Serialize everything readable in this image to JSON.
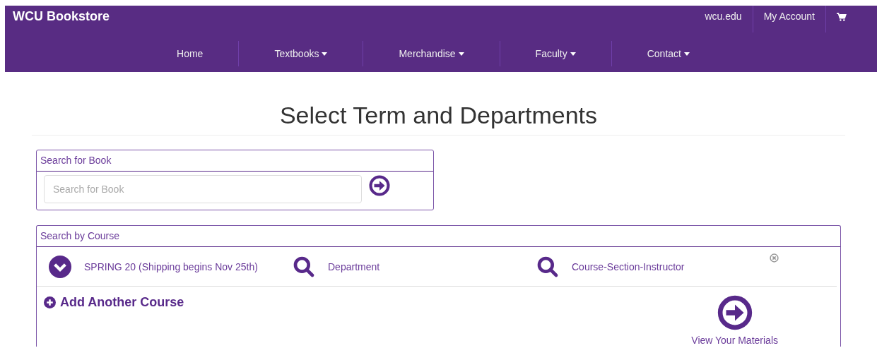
{
  "header": {
    "title": "WCU Bookstore",
    "top_links": [
      {
        "label": "wcu.edu",
        "kind": "text"
      },
      {
        "label": "My Account",
        "kind": "text"
      },
      {
        "kind": "cart"
      }
    ],
    "nav": [
      {
        "label": "Home",
        "dropdown": false
      },
      {
        "label": "Textbooks",
        "dropdown": true
      },
      {
        "label": "Merchandise",
        "dropdown": true
      },
      {
        "label": "Faculty",
        "dropdown": true
      },
      {
        "label": "Contact",
        "dropdown": true
      }
    ]
  },
  "page_title": "Select Term and Departments",
  "book_search": {
    "heading": "Search for Book",
    "placeholder": "Search for Book"
  },
  "course_search": {
    "heading": "Search by Course",
    "fields": [
      {
        "kind": "dropdown",
        "label": "SPRING 20 (Shipping begins Nov 25th)"
      },
      {
        "kind": "search",
        "label": "Department"
      },
      {
        "kind": "search",
        "label": "Course-Section-Instructor"
      }
    ],
    "add_course": "Add Another Course",
    "view_materials": "View Your Materials"
  }
}
